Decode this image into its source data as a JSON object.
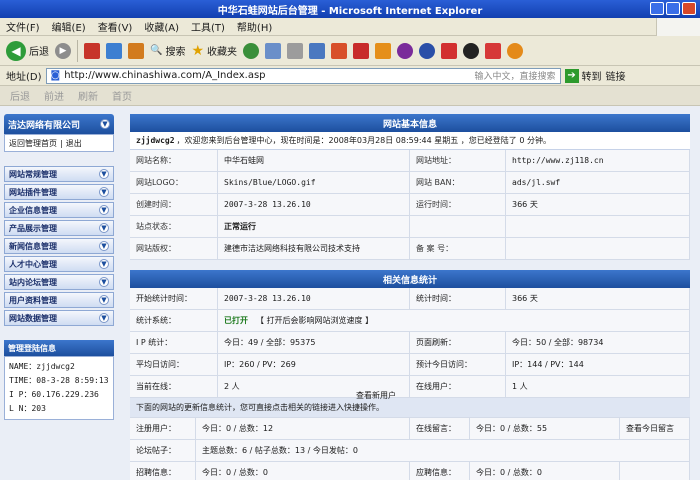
{
  "window": {
    "title": "中华石蛙网站后台管理 - Microsoft Internet Explorer"
  },
  "menu": [
    "文件(F)",
    "编辑(E)",
    "查看(V)",
    "收藏(A)",
    "工具(T)",
    "帮助(H)"
  ],
  "toolbar": {
    "back": "后退",
    "search": "搜索",
    "favorites": "收藏夹"
  },
  "address": {
    "label": "地址(D)",
    "url": "http://www.chinashiwa.com/A_Index.asp",
    "hint": "输入中文，直接搜索",
    "go": "转到",
    "links": "链接"
  },
  "nav2": [
    "后退",
    "前进",
    "刷新",
    "首页"
  ],
  "sidebar": {
    "company": "洁达网络有限公司",
    "return_home": "返回管理首页",
    "logout": "退出",
    "items": [
      "网站常规管理",
      "网站插件管理",
      "企业信息管理",
      "产品展示管理",
      "新闻信息管理",
      "人才中心管理",
      "站内论坛管理",
      "用户资料管理",
      "网站数据管理"
    ],
    "login_title": "管理登陆信息",
    "login": {
      "name": "NAME：zjjdwcg2",
      "time": "TIME：08-3-28 8:59:13",
      "ip": "I P：60.176.229.236",
      "login_count": "L N：203"
    }
  },
  "panel1": {
    "title": "网站基本信息",
    "welcome_user": "zjjdwcg2",
    "welcome_text": "，欢迎您来到后台管理中心，现在时间是：2008年03月28日 08:59:44 星期五 ，您已经登陆了 0 分钟。",
    "rows": [
      [
        "网站名称：",
        "中华石蛙网",
        "网站地址：",
        "http://www.zj118.cn"
      ],
      [
        "网站LOGO：",
        "Skins/Blue/LOGO.gif",
        "网站 BAN：",
        "ads/jl.swf"
      ],
      [
        "创建时间：",
        "2007-3-28 13.26.10",
        "运行时间：",
        "366 天"
      ],
      [
        "站点状态：",
        "正常运行",
        "",
        ""
      ],
      [
        "网站版权：",
        "建德市洁达网络科技有限公司技术支持",
        "备 案 号：",
        ""
      ]
    ]
  },
  "panel2": {
    "title": "相关信息统计",
    "rows": [
      [
        "开始统计时间：",
        "2007-3-28 13.26.10",
        "统计时间：",
        "366 天"
      ],
      [
        "统计系统：",
        "已打开",
        "【 打开后会影响网站浏览速度 】",
        ""
      ],
      [
        "I P 统计：",
        "今日：49 / 全部：95375",
        "页面刷新：",
        "今日：50 / 全部：98734"
      ],
      [
        "平均日访问：",
        "IP：260 / PV：269",
        "预计今日访问：",
        "IP：144 / PV：144"
      ],
      [
        "当前在线：",
        "2 人",
        "在线用户：",
        "1 人"
      ]
    ],
    "note": "下面的网站的更新信息统计，您可直接点击相关的链接进入快捷操作。",
    "rows3": [
      [
        "注册用户：",
        "今日：0 / 总数：12",
        "查看新用户",
        "在线留言：",
        "今日：0 / 总数：55",
        "查看今日留言"
      ],
      [
        "论坛帖子：",
        "主题总数：6 / 帖子总数：13 / 今日发帖：0",
        "",
        "",
        "",
        ""
      ],
      [
        "招聘信息：",
        "今日：0 / 总数：0",
        "",
        "应聘信息：",
        "今日：0 / 总数：0",
        ""
      ]
    ]
  }
}
